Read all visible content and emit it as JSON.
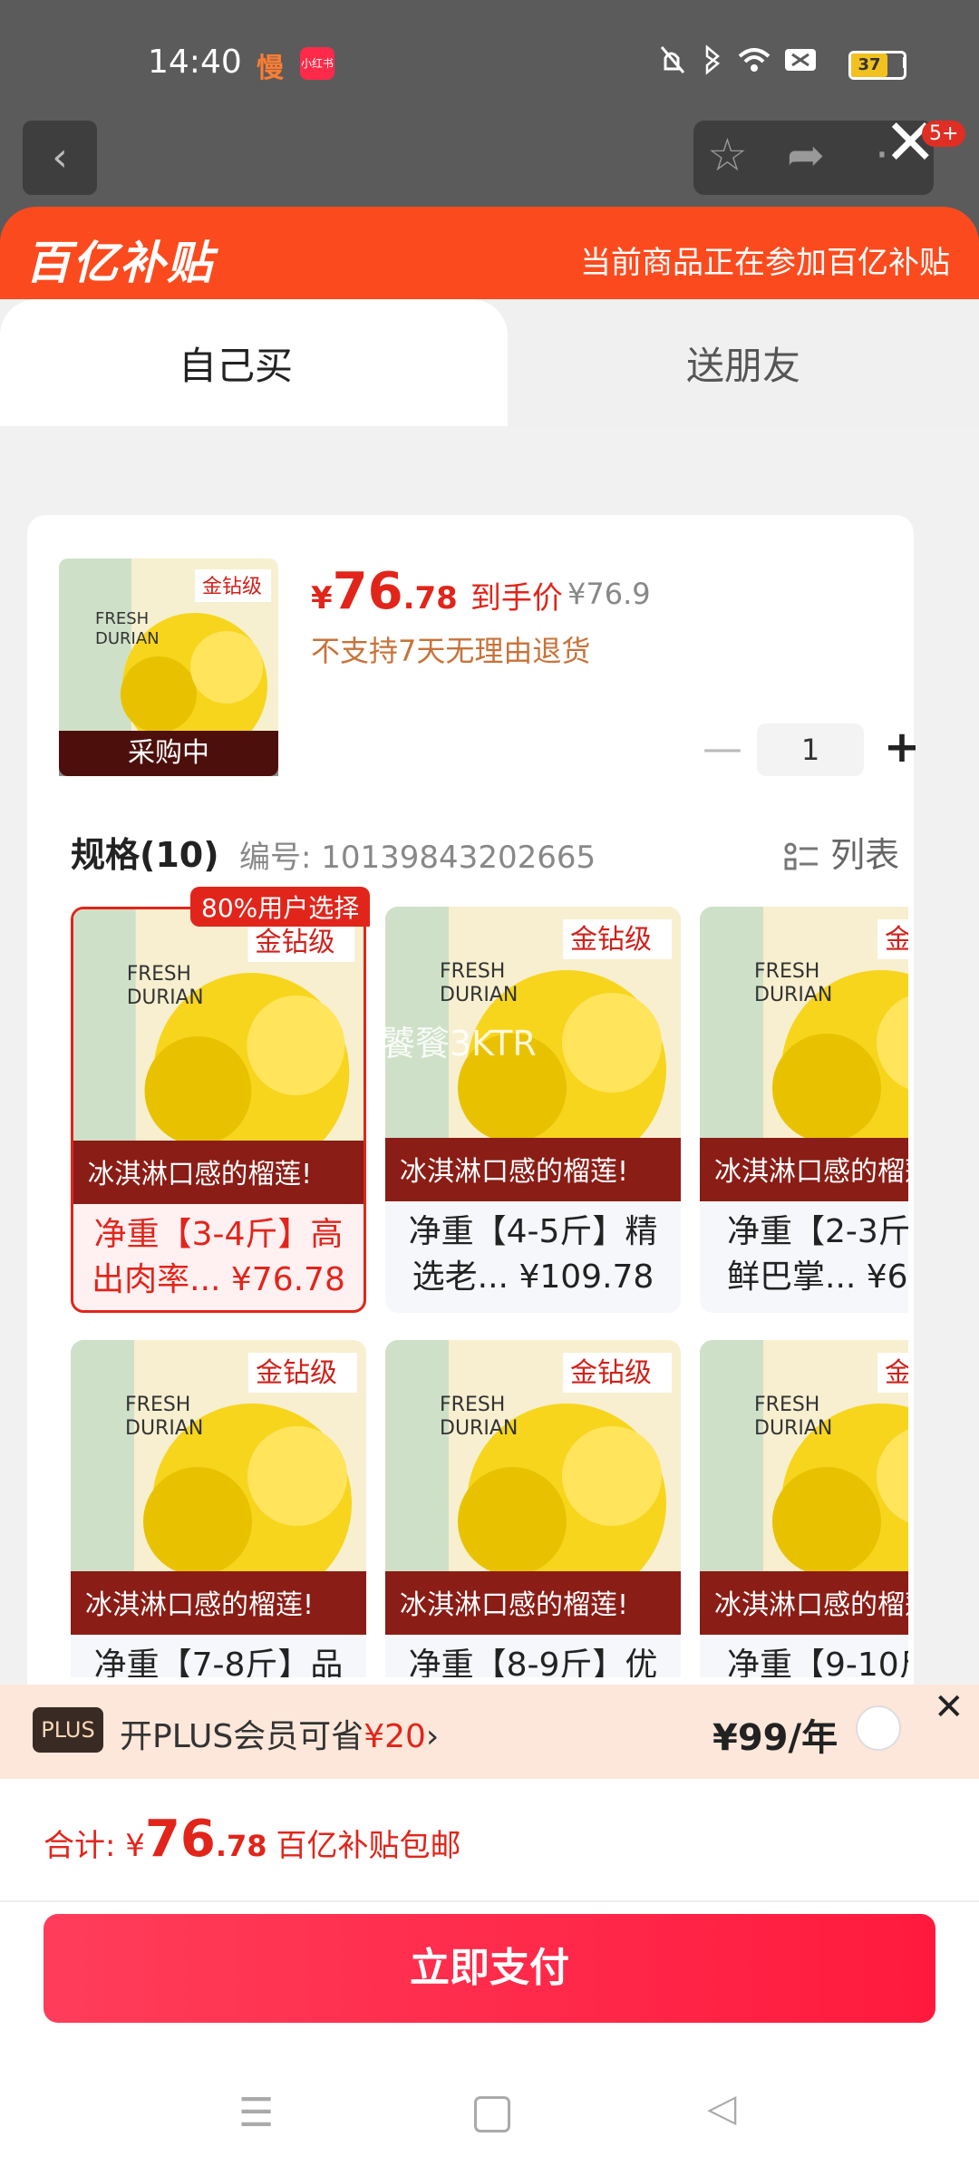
{
  "status_bar": {
    "time": "14:40",
    "app_icon_1": "慢",
    "app_icon_2": "小红书",
    "battery": "37"
  },
  "underlay": {
    "notification_count": "5+"
  },
  "header": {
    "brand": "百亿补贴",
    "notice": "当前商品正在参加百亿补贴"
  },
  "tabs": [
    {
      "label": "自己买"
    },
    {
      "label": "送朋友"
    }
  ],
  "product": {
    "price_symbol": "¥",
    "price_int": "76",
    "price_dec": ".78",
    "price_label": "到手价",
    "original_price": "¥76.9",
    "return_policy": "不支持7天无理由退货",
    "status_overlay": "采购中",
    "quantity": "1"
  },
  "spec": {
    "title": "规格(10)",
    "code": "编号: 10139843202665",
    "list_label": "列表",
    "top_badge": "80%用户选择",
    "watermark": "饕餮3KTR"
  },
  "spec_items": [
    {
      "line1": "净重【3-4斤】高",
      "line2": "出肉率... ¥76.78"
    },
    {
      "line1": "净重【4-5斤】精",
      "line2": "选老... ¥109.78"
    },
    {
      "line1": "净重【2-3斤",
      "line2": "鲜巴掌... ¥6"
    },
    {
      "line1": "净重【7-8斤】品",
      "line2": ""
    },
    {
      "line1": "净重【8-9斤】优",
      "line2": ""
    },
    {
      "line1": "净重【9-10斤",
      "line2": ""
    }
  ],
  "plus": {
    "badge": "PLUS",
    "text_prefix": "开PLUS会员可省",
    "save_amount": "¥20",
    "arrow": "›",
    "price": "¥99/年"
  },
  "footer": {
    "total_label": "合计: ¥",
    "total_int": "76",
    "total_dec": ".78",
    "shipping": "百亿补贴包邮",
    "pay_button": "立即支付"
  },
  "colors": {
    "accent": "#e1251b",
    "header": "#fb4b1e",
    "pay": "#ff1a3d"
  }
}
